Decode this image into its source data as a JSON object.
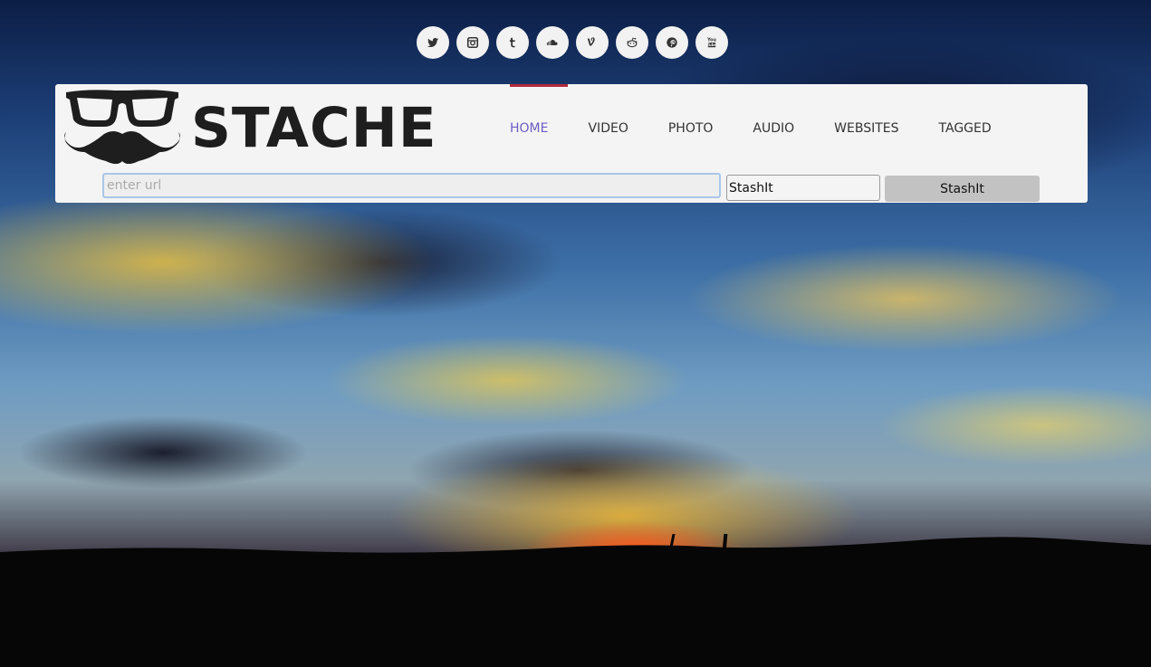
{
  "social": [
    {
      "name": "twitter-icon",
      "label": "twitter"
    },
    {
      "name": "instagram-icon",
      "label": "instagram"
    },
    {
      "name": "tumblr-icon",
      "label": "tumblr"
    },
    {
      "name": "soundcloud-icon",
      "label": "soundcloud"
    },
    {
      "name": "vine-icon",
      "label": "vine"
    },
    {
      "name": "reddit-icon",
      "label": "reddit"
    },
    {
      "name": "pinterest-icon",
      "label": "pinterest"
    },
    {
      "name": "youtube-icon",
      "label": "youtube"
    }
  ],
  "header": {
    "brand": "STACHE",
    "logo_icon": "glasses-mustache-icon"
  },
  "nav": {
    "items": [
      "HOME",
      "VIDEO",
      "PHOTO",
      "AUDIO",
      "WEBSITES",
      "TAGGED"
    ],
    "active": "HOME"
  },
  "form": {
    "url_placeholder": "enter url",
    "url_value": "",
    "stash_field_value": "StashIt",
    "stash_button_label": "StashIt"
  },
  "colors": {
    "accent_active_text": "#6a5fc4",
    "active_bar": "#b22b3a",
    "header_bg": "#f4f4f4"
  }
}
